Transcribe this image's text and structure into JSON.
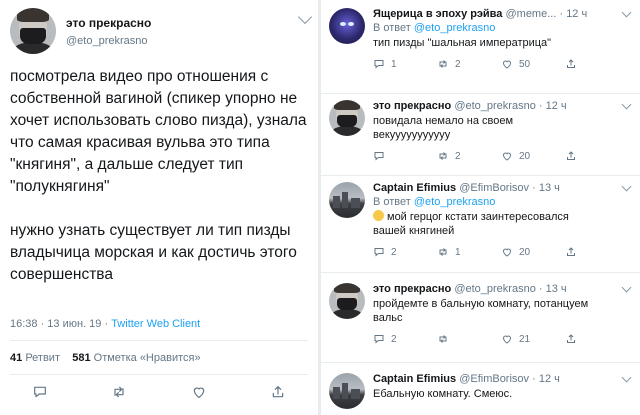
{
  "main": {
    "name": "это прекрасно",
    "handle": "@eto_prekrasno",
    "paragraphs": [
      "посмотрела видео про отношения с собственной вагиной (спикер упорно не хочет использовать слово пизда), узнала что самая красивая вульва это типа \"княгиня\", а дальше следует тип \"полукнягиня\"",
      "нужно узнать существует ли тип пизды владычица морская и как достичь этого совершенства"
    ],
    "timestamp": "16:38 · 13 июн. 19 · ",
    "client": "Twitter Web Client",
    "retweets_count": "41",
    "retweets_label": "Ретвит",
    "likes_count": "581",
    "likes_label": "Отметка «Нравится»"
  },
  "replies": [
    {
      "name": "Ящерица в эпоху рэйва",
      "handle": "@meme...",
      "time": "12 ч",
      "reply_to_label": "В ответ",
      "reply_to": "@eto_prekrasno",
      "text": "тип пизды \"шальная императрица\"",
      "replies": "1",
      "retweets": "2",
      "likes": "50",
      "avatar": "alien-avatar"
    },
    {
      "name": "это прекрасно",
      "handle": "@eto_prekrasno",
      "time": "12 ч",
      "reply_to_label": "",
      "reply_to": "",
      "text": "повидала немало на своем векууууууууууу",
      "replies": "",
      "retweets": "2",
      "likes": "20",
      "avatar": "masked-face-avatar"
    },
    {
      "name": "Captain Efimius",
      "handle": "@EfimBorisov",
      "time": "13 ч",
      "reply_to_label": "В ответ",
      "reply_to": "@eto_prekrasno",
      "text": "мой герцог кстати заинтересовался вашей княгиней",
      "emoji": "tears-of-joy-emoji",
      "replies": "2",
      "retweets": "1",
      "likes": "20",
      "avatar": "city-avatar"
    },
    {
      "name": "это прекрасно",
      "handle": "@eto_prekrasno",
      "time": "13 ч",
      "reply_to_label": "",
      "reply_to": "",
      "text": "пройдемте в бальную комнату, потанцуем вальс",
      "replies": "2",
      "retweets": "",
      "likes": "21",
      "avatar": "masked-face-avatar"
    },
    {
      "name": "Captain Efimius",
      "handle": "@EfimBorisov",
      "time": "12 ч",
      "reply_to_label": "",
      "reply_to": "",
      "text": "Ебальную комнату. Смеюс.",
      "replies": "",
      "retweets": "",
      "likes": "",
      "avatar": "city-avatar"
    }
  ],
  "colors": {
    "accent": "#1da1f2",
    "muted": "#657786",
    "text": "#14171a",
    "divider": "#e6ecf0"
  }
}
